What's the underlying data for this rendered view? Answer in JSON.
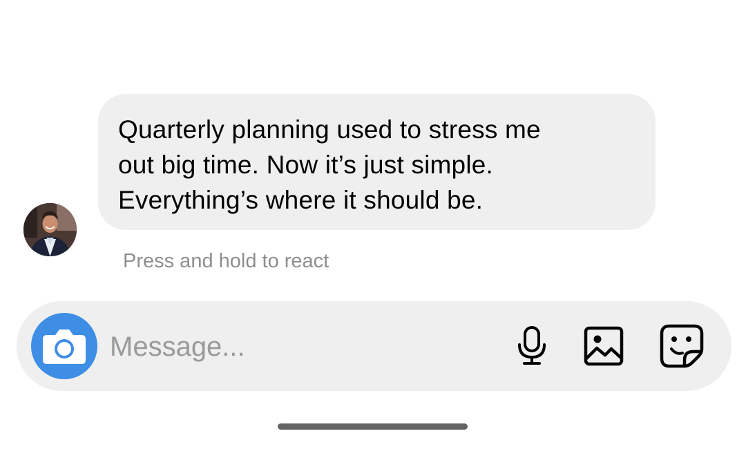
{
  "message": {
    "lines": [
      "Quarterly planning used to stress me",
      "out big time. Now it’s just simple.",
      "Everything’s where it should be."
    ]
  },
  "hint": "Press and hold to react",
  "composer": {
    "placeholder": "Message..."
  },
  "icons": {
    "camera": "camera-icon",
    "mic": "microphone-icon",
    "gallery": "image-icon",
    "sticker": "sticker-icon"
  },
  "colors": {
    "accent": "#3e8ee6",
    "bubble": "#efefef",
    "hint_text": "#8e8e8e"
  }
}
